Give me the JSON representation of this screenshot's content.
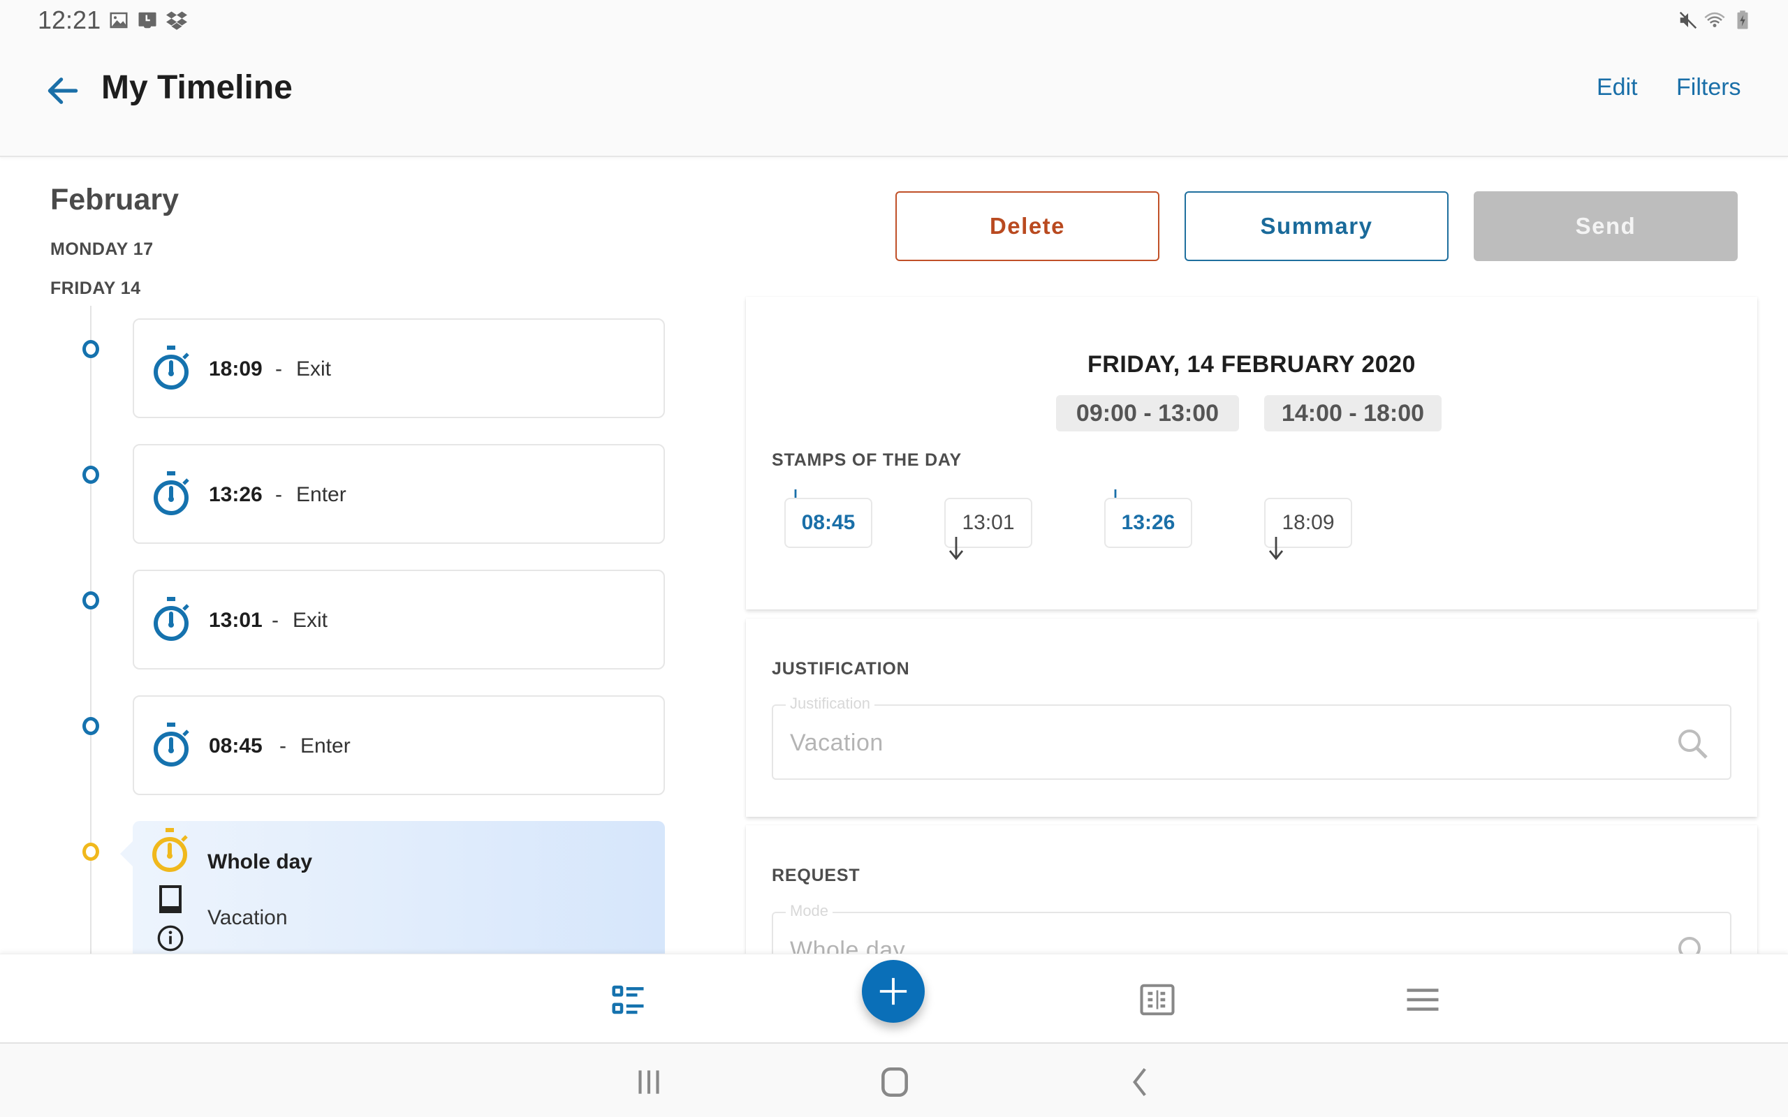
{
  "status_bar": {
    "time": "12:21",
    "left_icons": [
      "image-icon",
      "screenshot-icon",
      "dropbox-icon"
    ],
    "right_icons": [
      "mute-icon",
      "wifi-icon",
      "battery-charging-icon"
    ]
  },
  "app_bar": {
    "title": "My Timeline",
    "back_icon": "arrow-left-icon",
    "edit_label": "Edit",
    "filters_label": "Filters"
  },
  "timeline": {
    "month": "February",
    "days": [
      "MONDAY 17",
      "FRIDAY 14"
    ],
    "entries": [
      {
        "time": "18:09",
        "separator": "-",
        "kind": "Exit"
      },
      {
        "time": "13:26",
        "separator": "-",
        "kind": "Enter"
      },
      {
        "time": "13:01",
        "separator": "-",
        "kind": "Exit"
      },
      {
        "time": "08:45",
        "separator": "-",
        "kind": "Enter"
      }
    ],
    "selected_entry": {
      "title": "Whole day",
      "subtitle": "Vacation"
    }
  },
  "actions": {
    "delete_label": "Delete",
    "summary_label": "Summary",
    "send_label": "Send"
  },
  "day_detail": {
    "date_title": "FRIDAY, 14 FEBRUARY 2020",
    "shifts": [
      "09:00 - 13:00",
      "14:00 - 18:00"
    ],
    "stamps_label": "STAMPS OF THE DAY",
    "stamps": [
      {
        "time": "08:45",
        "direction": "enter"
      },
      {
        "time": "13:01",
        "direction": "exit"
      },
      {
        "time": "13:26",
        "direction": "enter"
      },
      {
        "time": "18:09",
        "direction": "exit"
      }
    ]
  },
  "justification": {
    "section_label": "JUSTIFICATION",
    "field_label": "Justification",
    "value": "Vacation"
  },
  "request": {
    "section_label": "REQUEST",
    "field_label": "Mode",
    "value": "Whole day"
  },
  "bottom_nav": {
    "items": [
      "timeline-list-icon",
      "add-icon",
      "calendar-grid-icon",
      "menu-icon"
    ]
  },
  "colors": {
    "accent": "#1a6fa8",
    "fab": "#0a6fb8",
    "delete": "#b94a20",
    "highlight": "#f0b81c",
    "disabled": "#bdbdbd"
  }
}
